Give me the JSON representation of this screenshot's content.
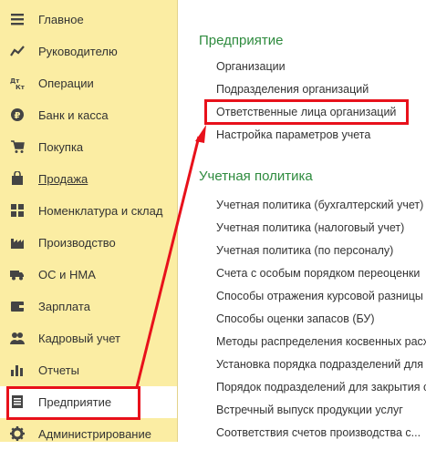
{
  "sidebar": {
    "items": [
      {
        "label": "Главное",
        "icon": "menu-icon"
      },
      {
        "label": "Руководителю",
        "icon": "trend-chart-icon"
      },
      {
        "label": "Операции",
        "icon": "debit-credit-icon"
      },
      {
        "label": "Банк и касса",
        "icon": "ruble-coin-icon"
      },
      {
        "label": "Покупка",
        "icon": "cart-icon"
      },
      {
        "label": "Продажа",
        "icon": "shopping-bag-icon"
      },
      {
        "label": "Номенклатура и склад",
        "icon": "grid-icon"
      },
      {
        "label": "Производство",
        "icon": "factory-icon"
      },
      {
        "label": "ОС и НМА",
        "icon": "truck-icon"
      },
      {
        "label": "Зарплата",
        "icon": "wallet-icon"
      },
      {
        "label": "Кадровый учет",
        "icon": "people-icon"
      },
      {
        "label": "Отчеты",
        "icon": "bar-chart-icon"
      },
      {
        "label": "Предприятие",
        "icon": "document-icon"
      },
      {
        "label": "Администрирование",
        "icon": "gear-icon"
      }
    ],
    "selected_index": 12
  },
  "content": {
    "section1_title": "Предприятие",
    "section1_links": [
      "Организации",
      "Подразделения организаций",
      "Ответственные лица организаций",
      "Настройка параметров учета"
    ],
    "section2_title": "Учетная политика",
    "section2_links": [
      "Учетная политика (бухгалтерский учет)",
      "Учетная политика (налоговый учет)",
      "Учетная политика (по персоналу)",
      "Счета с особым порядком переоценки",
      "Способы отражения курсовой разницы",
      "Способы оценки запасов (БУ)",
      "Методы распределения косвенных расходов",
      "Установка порядка подразделений для закрытия",
      "Порядок подразделений для закрытия счетов",
      "Встречный выпуск продукции услуг",
      "Соответствия счетов производства с..."
    ]
  },
  "colors": {
    "sidebar_bg": "#fbeda3",
    "section_title": "#2e8b3e",
    "annotation_red": "#e8111b"
  }
}
